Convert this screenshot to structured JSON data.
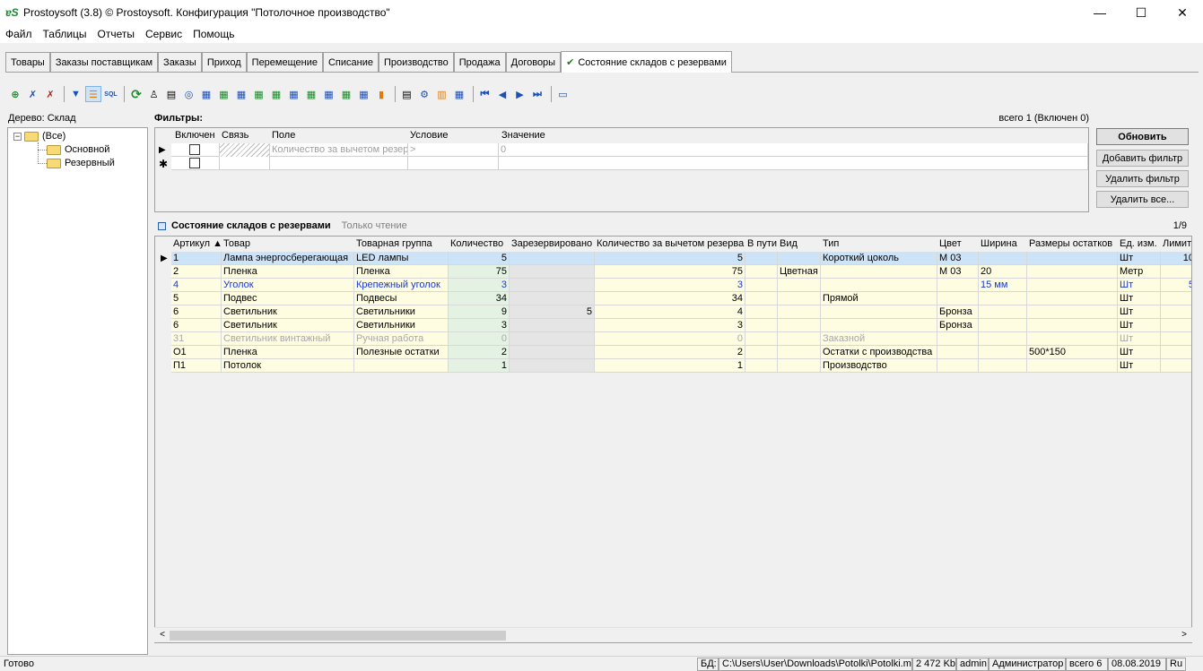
{
  "window": {
    "logo": "ɐS",
    "title": "Prostoysoft (3.8) © Prostoysoft. Конфигурация \"Потолочное производство\"",
    "minimize": "—",
    "maximize": "☐",
    "close": "✕"
  },
  "menu": [
    "Файл",
    "Таблицы",
    "Отчеты",
    "Сервис",
    "Помощь"
  ],
  "tabs": [
    {
      "label": "Товары",
      "active": false
    },
    {
      "label": "Заказы поставщикам",
      "active": false
    },
    {
      "label": "Заказы",
      "active": false
    },
    {
      "label": "Приход",
      "active": false
    },
    {
      "label": "Перемещение",
      "active": false
    },
    {
      "label": "Списание",
      "active": false
    },
    {
      "label": "Производство",
      "active": false
    },
    {
      "label": "Продажа",
      "active": false
    },
    {
      "label": "Договоры",
      "active": false
    },
    {
      "label": "Состояние складов с резервами",
      "active": true,
      "check": "✔"
    }
  ],
  "toolbar": {
    "icons": [
      "filter-add-icon",
      "filter-remove-icon",
      "filter-clear-icon",
      "filter-toggle-icon",
      "tree-filter-icon",
      "sql-icon",
      "refresh-icon",
      "find-icon",
      "print-icon",
      "preview-icon",
      "export-html-icon",
      "export-excel-icon",
      "export-word-icon",
      "export-csv-icon",
      "export-xml-icon",
      "export-txt-icon",
      "export-dbf-icon",
      "export-xls2-icon",
      "chart-icon",
      "report-icon",
      "settings-icon",
      "columns-icon",
      "table-icon",
      "first-record-icon",
      "prev-record-icon",
      "next-record-icon",
      "last-record-icon",
      "comment-icon"
    ],
    "colors": {
      "green": "#1b8a2a",
      "blue": "#1c4fb8",
      "red": "#c41e1e",
      "orange": "#e07b0c"
    }
  },
  "tree": {
    "label": "Дерево: Склад",
    "nodes": [
      {
        "label": "(Все)",
        "expander": "−"
      },
      {
        "label": "Основной"
      },
      {
        "label": "Резервный"
      }
    ]
  },
  "filters": {
    "label": "Фильтры:",
    "count": "всего 1 (Включен 0)",
    "headers": {
      "enabled": "Включен",
      "link": "Связь",
      "field": "Поле",
      "condition": "Условие",
      "value": "Значение"
    },
    "row": {
      "field": "Количество за вычетом резерва",
      "condition": ">",
      "value": "0"
    },
    "current_marker": "▶",
    "new_marker": "✱",
    "buttons": {
      "refresh": "Обновить",
      "add": "Добавить фильтр",
      "remove": "Удалить фильтр",
      "remove_all": "Удалить все..."
    }
  },
  "grid": {
    "title": "Состояние складов с резервами",
    "subtitle": "Только чтение",
    "page": "1/9",
    "current_marker": "▶",
    "columns": [
      "Артикул ▲",
      "Товар",
      "Товарная группа",
      "Количество",
      "Зарезервировано",
      "Количество за вычетом резерва",
      "В пути",
      "Вид",
      "Тип",
      "Цвет",
      "Ширина",
      "Размеры остатков",
      "Ед. изм.",
      "Лимит"
    ],
    "rows": [
      {
        "style": "selected",
        "cells": [
          "1",
          "Лампа энергосберегающая",
          "LED лампы",
          "5",
          "",
          "5",
          "",
          "",
          "Короткий цоколь",
          "M 03",
          "",
          "",
          "Шт",
          "10"
        ]
      },
      {
        "style": "normal",
        "cells": [
          "2",
          "Пленка",
          "Пленка",
          "75",
          "",
          "75",
          "",
          "Цветная",
          "",
          "M 03",
          "20",
          "",
          "Метр",
          ""
        ]
      },
      {
        "style": "blue",
        "cells": [
          "4",
          "Уголок",
          "Крепежный уголок",
          "3",
          "",
          "3",
          "",
          "",
          "",
          "",
          "15 мм",
          "",
          "Шт",
          "5"
        ]
      },
      {
        "style": "normal",
        "cells": [
          "5",
          "Подвес",
          "Подвесы",
          "34",
          "",
          "34",
          "",
          "",
          "Прямой",
          "",
          "",
          "",
          "Шт",
          ""
        ]
      },
      {
        "style": "normal",
        "cells": [
          "6",
          "Светильник",
          "Светильники",
          "9",
          "5",
          "4",
          "",
          "",
          "",
          "Бронза",
          "",
          "",
          "Шт",
          ""
        ]
      },
      {
        "style": "normal",
        "cells": [
          "6",
          "Светильник",
          "Светильники",
          "3",
          "",
          "3",
          "",
          "",
          "",
          "Бронза",
          "",
          "",
          "Шт",
          ""
        ]
      },
      {
        "style": "gray",
        "cells": [
          "31",
          "Светильник винтажный",
          "Ручная работа",
          "0",
          "",
          "0",
          "",
          "",
          "Заказной",
          "",
          "",
          "",
          "Шт",
          ""
        ]
      },
      {
        "style": "normal",
        "cells": [
          "О1",
          "Пленка",
          "Полезные остатки",
          "2",
          "",
          "2",
          "",
          "",
          "Остатки с производства",
          "",
          "",
          "500*150",
          "Шт",
          ""
        ]
      },
      {
        "style": "normal",
        "cells": [
          "П1",
          "Потолок",
          "",
          "1",
          "",
          "1",
          "",
          "",
          "Производство",
          "",
          "",
          "",
          "Шт",
          ""
        ]
      }
    ],
    "scroll_left": "<",
    "scroll_right": ">"
  },
  "status": {
    "ready": "Готово",
    "db_label": "БД:",
    "db_path": "C:\\Users\\User\\Downloads\\Potolki\\Potolki.mdb",
    "db_size": "2 472 Kb",
    "user": "admin",
    "role": "Администратор",
    "total": "всего 6",
    "date": "08.08.2019",
    "lang": "Ru"
  }
}
